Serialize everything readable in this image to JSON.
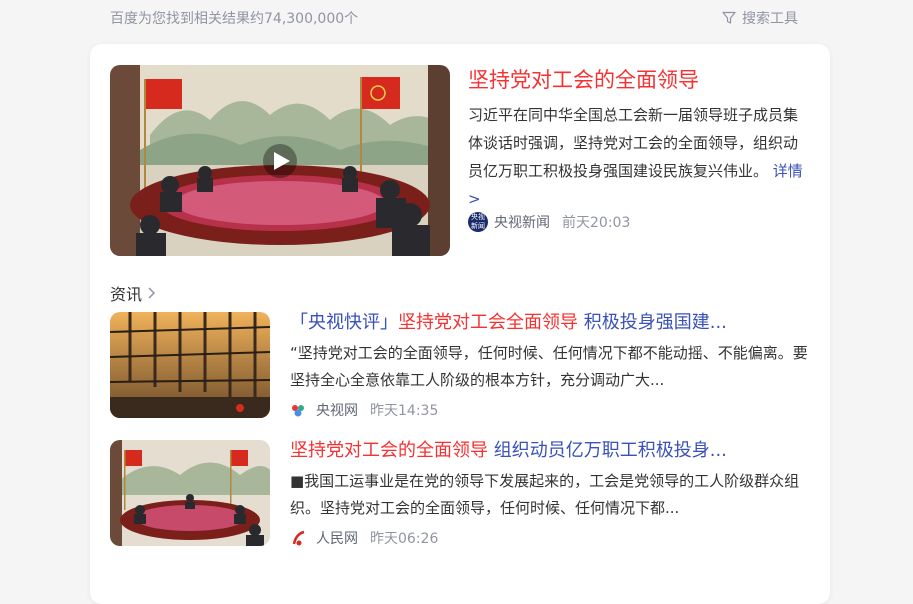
{
  "result_count": "百度为您找到相关结果约74,300,000个",
  "search_tools": "搜索工具",
  "feature": {
    "title": "坚持党对工会的全面领导",
    "desc": "习近平在同中华全国总工会新一届领导班子成员集体谈话时强调，坚持党对工会的全面领导，组织动员亿万职工积极投身强国建设民族复兴伟业。",
    "detail": "详情 >",
    "source": "央视新闻",
    "logo_text": "央视\n新闻",
    "time": "前天20:03"
  },
  "section": {
    "label": "资讯"
  },
  "news": [
    {
      "title_parts": [
        "「央视快评」",
        "坚持党对工会全面领导",
        " 积极投身强国建..."
      ],
      "desc": "“坚持党对工会的全面领导，任何时候、任何情况下都不能动摇、不能偏离。要坚持全心全意依靠工人阶级的根本方针，充分调动广大...",
      "source": "央视网",
      "time": "昨天14:35"
    },
    {
      "title_parts": [
        "坚持党对工会的全面领导",
        " 组织动员亿万职工积极投身..."
      ],
      "desc": "■我国工运事业是在党的领导下发展起来的，工会是党领导的工人阶级群众组织。坚持党对工会的全面领导，任何时候、任何情况下都...",
      "source": "人民网",
      "time": "昨天06:26"
    }
  ],
  "colors": {
    "highlight": "#f73131",
    "link": "#3951b8",
    "meta": "#9195a3"
  }
}
